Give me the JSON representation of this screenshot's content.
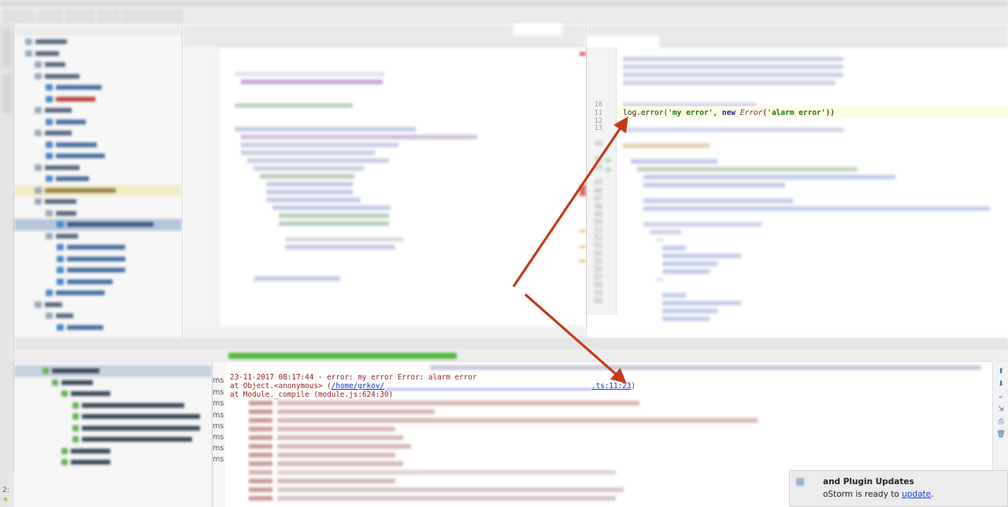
{
  "editor_right": {
    "line_numbers": [
      "10",
      "11",
      "12",
      "13",
      "40",
      "42",
      "43",
      "45",
      "46",
      "47",
      "48",
      "49",
      "50",
      "51",
      "52",
      "53",
      "54",
      "55",
      "56",
      "57",
      "58",
      "59",
      "60"
    ],
    "focus_line": {
      "line_number": "11",
      "fn": "log.error(",
      "arg1": "'my error'",
      "sep": ", ",
      "kw_new": "new",
      "cls": "Error",
      "arg2": "'alarm error'",
      "close": "))"
    }
  },
  "test_tree": {
    "durations": [
      "ms",
      "ms",
      "ms",
      "ms",
      "ms",
      "ms",
      "ms",
      "ms"
    ]
  },
  "console": {
    "lines": {
      "l1": "23-11-2017 08:17:44 - error: my error Error: alarm error",
      "l2_prefix": "    at Object.<anonymous> (",
      "l2_link_visible": "/home/grkov/",
      "l2_link_tail": ".ts:11:23",
      "l2_close": ")",
      "l3": "    at Module._compile (module.js:624:30)"
    }
  },
  "notification": {
    "title": "and Plugin Updates",
    "body_prefix": "oStorm is ready to ",
    "link": "update",
    "body_suffix": "."
  },
  "left_strip": {
    "bottom_label": "2:",
    "star": "★"
  },
  "colors": {
    "arrow": "#c43a1a",
    "console_error": "#9a1b1b",
    "link": "#1830c8",
    "progress": "#57b543"
  }
}
